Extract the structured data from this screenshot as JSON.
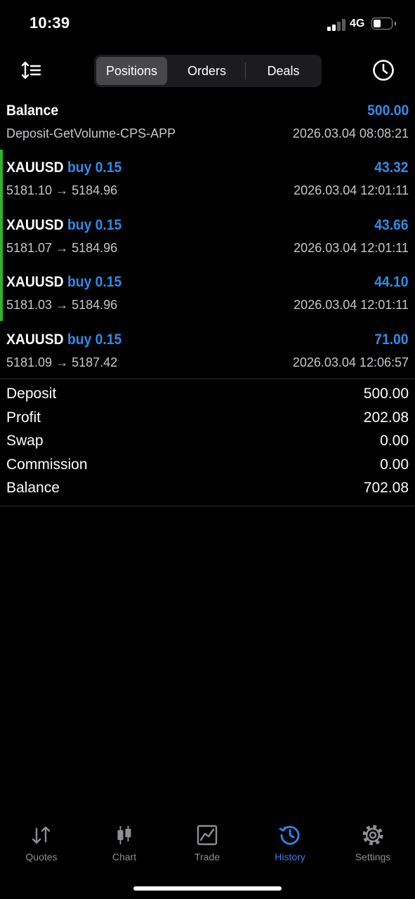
{
  "status_bar": {
    "time": "10:39",
    "network": "4G"
  },
  "toolbar": {
    "tabs": [
      {
        "label": "Positions",
        "active": true
      },
      {
        "label": "Orders",
        "active": false
      },
      {
        "label": "Deals",
        "active": false
      }
    ]
  },
  "balance_entry": {
    "label": "Balance",
    "amount": "500.00",
    "comment": "Deposit-GetVolume-CPS-APP",
    "time": "2026.03.04 08:08:21"
  },
  "deals": [
    {
      "symbol": "XAUUSD",
      "side": "buy 0.15",
      "prices": "5181.10 → 5184.96",
      "profit": "43.32",
      "time": "2026.03.04 12:01:11"
    },
    {
      "symbol": "XAUUSD",
      "side": "buy 0.15",
      "prices": "5181.07 → 5184.96",
      "profit": "43.66",
      "time": "2026.03.04 12:01:11"
    },
    {
      "symbol": "XAUUSD",
      "side": "buy 0.15",
      "prices": "5181.03 → 5184.96",
      "profit": "44.10",
      "time": "2026.03.04 12:01:11"
    },
    {
      "symbol": "XAUUSD",
      "side": "buy 0.15",
      "prices": "5181.09 → 5187.42",
      "profit": "71.00",
      "time": "2026.03.04 12:06:57"
    }
  ],
  "summary": {
    "deposit": {
      "label": "Deposit",
      "value": "500.00"
    },
    "profit": {
      "label": "Profit",
      "value": "202.08"
    },
    "swap": {
      "label": "Swap",
      "value": "0.00"
    },
    "commission": {
      "label": "Commission",
      "value": "0.00"
    },
    "balance": {
      "label": "Balance",
      "value": "702.08"
    }
  },
  "tabbar": {
    "items": [
      {
        "label": "Quotes",
        "icon": "arrows-updown-icon",
        "active": false
      },
      {
        "label": "Chart",
        "icon": "candlestick-icon",
        "active": false
      },
      {
        "label": "Trade",
        "icon": "trade-chart-icon",
        "active": false
      },
      {
        "label": "History",
        "icon": "history-clock-icon",
        "active": true
      },
      {
        "label": "Settings",
        "icon": "gear-icon",
        "active": false
      }
    ]
  },
  "colors": {
    "accent_blue": "#2f8ce8",
    "tab_active": "#2a86f0",
    "position_bar_green": "#2fb52a",
    "background": "#000000"
  }
}
